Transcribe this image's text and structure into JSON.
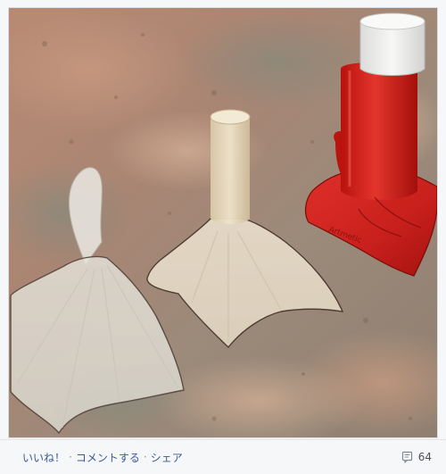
{
  "post": {
    "photo": {
      "subject": "three-wax-flipper-molds-on-granite"
    },
    "actions": [
      {
        "id": "like",
        "label": "いいね！"
      },
      {
        "id": "comment",
        "label": "コメントする"
      },
      {
        "id": "share",
        "label": "シェア"
      }
    ],
    "separator": "·",
    "comments": {
      "icon": "comment-bubble-icon",
      "count": "64"
    }
  },
  "colors": {
    "link": "#3b5998",
    "counter": "#4b4f56",
    "bar_background": "#f6f7f9"
  }
}
